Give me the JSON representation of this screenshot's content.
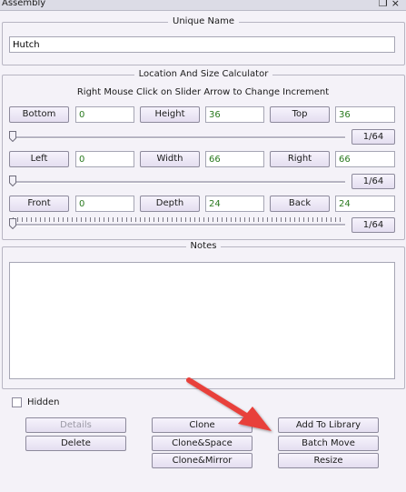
{
  "window": {
    "title": "Assembly"
  },
  "unique_name": {
    "legend": "Unique Name",
    "value": "Hutch"
  },
  "calculator": {
    "legend": "Location And Size Calculator",
    "hint": "Right Mouse Click on Slider Arrow to Change Increment",
    "rows": [
      {
        "a_label": "Bottom",
        "a_value": "0",
        "b_label": "Height",
        "b_value": "36",
        "c_label": "Top",
        "c_value": "36",
        "increment": "1/64"
      },
      {
        "a_label": "Left",
        "a_value": "0",
        "b_label": "Width",
        "b_value": "66",
        "c_label": "Right",
        "c_value": "66",
        "increment": "1/64"
      },
      {
        "a_label": "Front",
        "a_value": "0",
        "b_label": "Depth",
        "b_value": "24",
        "c_label": "Back",
        "c_value": "24",
        "increment": "1/64"
      }
    ]
  },
  "notes": {
    "legend": "Notes",
    "value": ""
  },
  "hidden": {
    "label": "Hidden",
    "checked": false
  },
  "buttons": {
    "details": "Details",
    "delete": "Delete",
    "clone": "Clone",
    "clone_space": "Clone&Space",
    "clone_mirror": "Clone&Mirror",
    "add_to_library": "Add To Library",
    "batch_move": "Batch Move",
    "resize": "Resize"
  },
  "colors": {
    "arrow": "#e8413a",
    "value_text": "#2a7a1f"
  },
  "icons": {
    "window_controls": [
      "restore-icon",
      "close-icon"
    ]
  }
}
